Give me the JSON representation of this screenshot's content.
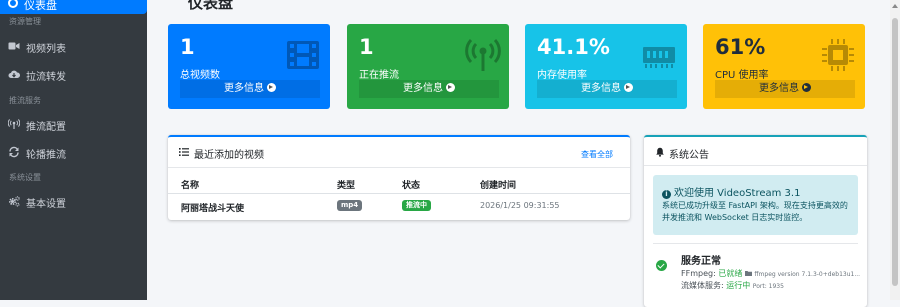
{
  "sidebar": {
    "active_label": "仪表盘",
    "sections": [
      {
        "header": "资源管理",
        "items": [
          {
            "label": "视频列表",
            "icon": "video-icon"
          },
          {
            "label": "拉流转发",
            "icon": "cloud-download-icon"
          }
        ]
      },
      {
        "header": "推流服务",
        "items": [
          {
            "label": "推流配置",
            "icon": "broadcast-icon"
          },
          {
            "label": "轮播推流",
            "icon": "sync-icon"
          }
        ]
      },
      {
        "header": "系统设置",
        "items": [
          {
            "label": "基本设置",
            "icon": "cogs-icon"
          }
        ]
      }
    ]
  },
  "page": {
    "title": "仪表盘"
  },
  "stats": [
    {
      "value": "1",
      "label": "总视频数",
      "more": "更多信息",
      "color": "#007bff",
      "icon": "film-icon"
    },
    {
      "value": "1",
      "label": "正在推流",
      "more": "更多信息",
      "color": "#28a745",
      "icon": "broadcast-tower-icon"
    },
    {
      "value": "41.1%",
      "label": "内存使用率",
      "more": "更多信息",
      "color": "#17a2b8",
      "icon": "memory-icon"
    },
    {
      "value": "61%",
      "label": "CPU 使用率",
      "more": "更多信息",
      "color": "#ffc107",
      "icon": "microchip-icon"
    }
  ],
  "recent_videos": {
    "title": "最近添加的视频",
    "view_all": "查看全部",
    "columns": [
      "名称",
      "类型",
      "状态",
      "创建时间"
    ],
    "rows": [
      {
        "name": "阿丽塔战斗天使",
        "type": "mp4",
        "status": "推流中",
        "created": "2026/1/25 09:31:55"
      }
    ]
  },
  "notice": {
    "title": "系统公告",
    "alert_title": "欢迎使用 VideoStream 3.1",
    "alert_body": "系统已成功升级至 FastAPI 架构。现在支持更高效的并发推流和 WebSocket 日志实时监控。",
    "service_title": "服务正常",
    "ffmpeg_label": "FFmpeg:",
    "ffmpeg_status": "已就绪",
    "ffmpeg_version": "ffmpeg version 7.1.3-0+deb13u1...",
    "media_label": "流媒体服务:",
    "media_status": "运行中",
    "media_port": "Port: 1935"
  }
}
